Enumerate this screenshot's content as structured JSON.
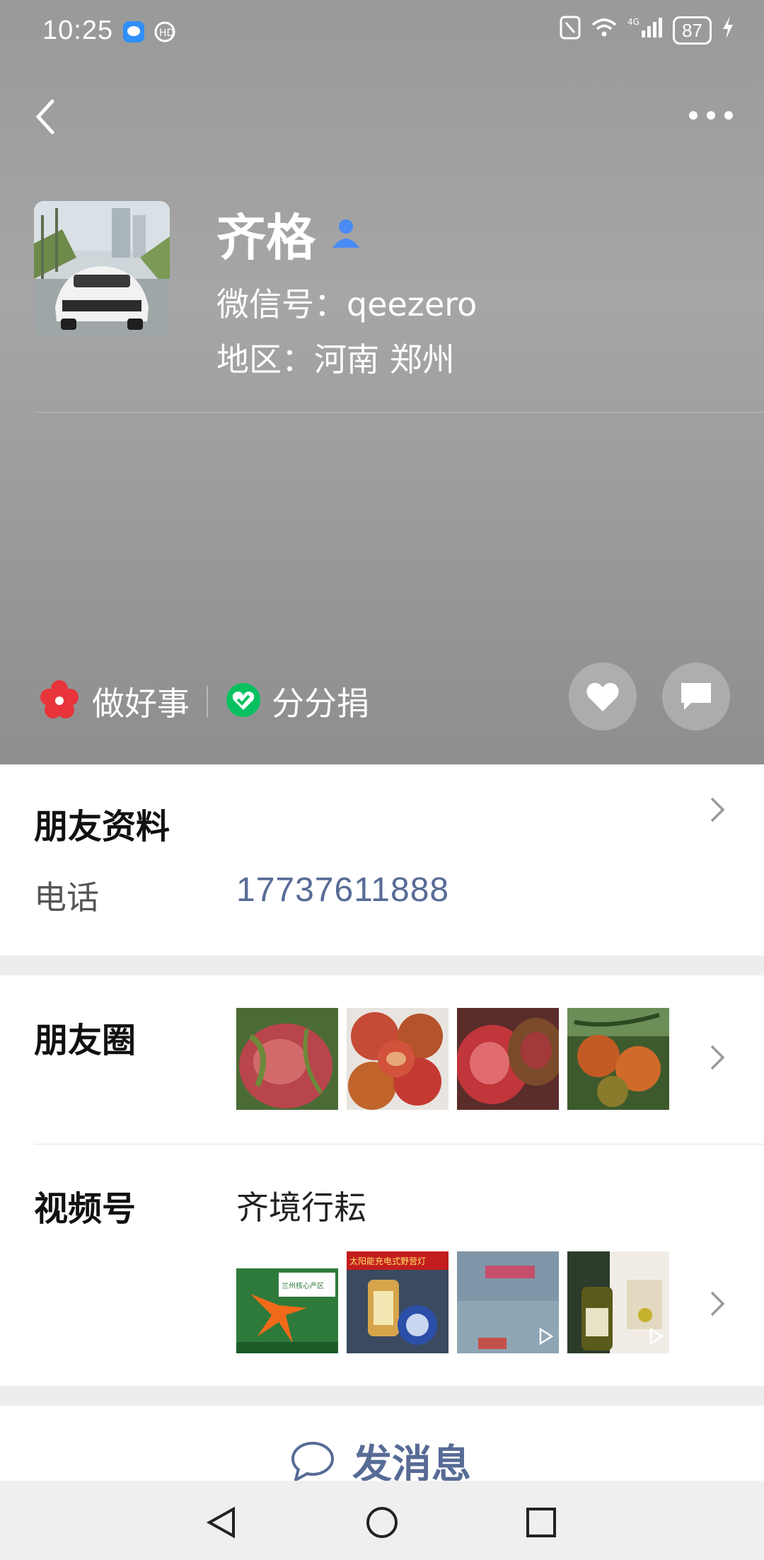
{
  "status_bar": {
    "time": "10:25",
    "battery": "87",
    "icons": [
      "message-app-icon",
      "hd-call-icon",
      "nfc-icon",
      "wifi-icon",
      "4g-signal-icon",
      "battery-icon",
      "charging-icon"
    ]
  },
  "profile": {
    "name": "齐格",
    "wechat_id": "微信号：qeezero",
    "region": "地区：河南  郑州",
    "avatar": "white-sports-car-photo"
  },
  "header_actions": {
    "good_deeds": "做好事",
    "donate": "分分捐"
  },
  "friend_info": {
    "title": "朋友资料",
    "phone_label": "电话",
    "phone_value": "17737611888"
  },
  "moments": {
    "title": "朋友圈",
    "thumbnails": [
      "tomato-cut-1",
      "tomato-pile",
      "tomato-cut-2",
      "tomato-on-vine"
    ]
  },
  "channels": {
    "title": "视频号",
    "channel_name": "齐境行耘",
    "thumbnails": [
      "lily-flower-poster",
      "solar-camping-lantern",
      "video-misty",
      "olive-oil-bottle"
    ],
    "thumb_texts": [
      "兰州核心产区",
      "太阳能充电式野营灯"
    ]
  },
  "send_message": {
    "label": "发消息"
  },
  "colors": {
    "link_blue": "#576b95",
    "header_gray": "#a6a6a6",
    "accent_red": "#e8343b",
    "accent_green": "#07c160"
  }
}
